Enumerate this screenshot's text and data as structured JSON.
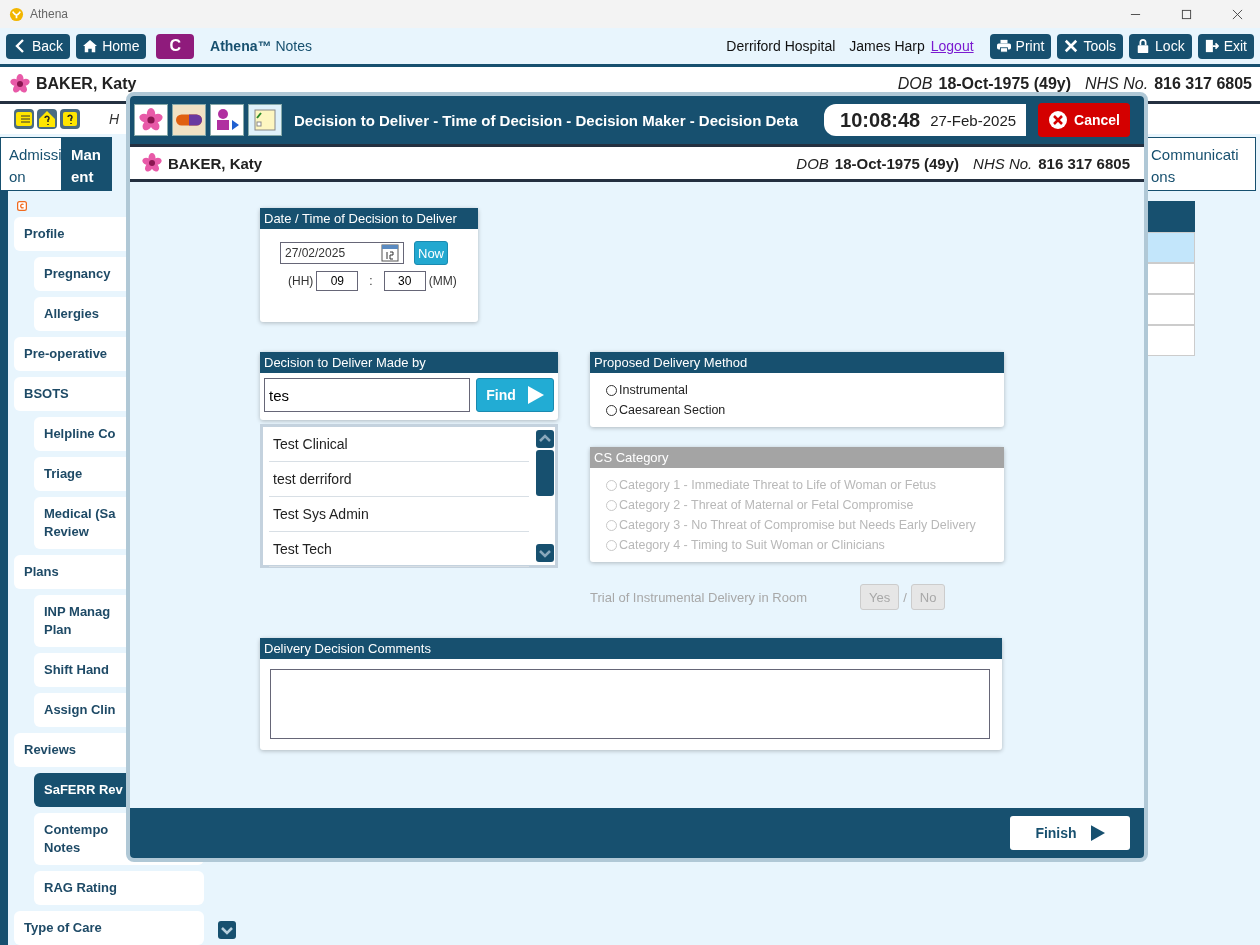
{
  "window": {
    "title": "Athena"
  },
  "toolbar": {
    "back": "Back",
    "home": "Home",
    "c_button": "C",
    "app_name": "Athena™",
    "app_suffix": "Notes",
    "hospital": "Derriford Hospital",
    "user": "James Harp",
    "logout": "Logout",
    "buttons": [
      {
        "kind": "print",
        "label": "Print"
      },
      {
        "kind": "tools",
        "label": "Tools"
      },
      {
        "kind": "lock",
        "label": "Lock"
      },
      {
        "kind": "exit",
        "label": "Exit"
      }
    ]
  },
  "patient": {
    "name": "BAKER, Katy",
    "dob_label": "DOB",
    "dob": "18-Oct-1975 (49y)",
    "nhs_label": "NHS No.",
    "nhs": "816 317 6805"
  },
  "icon_row_text": "H",
  "tabs": [
    {
      "lines": [
        "Admissi",
        "on"
      ],
      "selected": false
    },
    {
      "lines": [
        "Man",
        "ent"
      ],
      "selected": true
    },
    {
      "lines": [
        "Communicati",
        "ons"
      ],
      "selected": false
    }
  ],
  "sidebar": {
    "items": [
      {
        "lines": [
          "Profile"
        ],
        "selected": false,
        "children": [
          {
            "lines": [
              "Pregnancy"
            ],
            "selected": false
          },
          {
            "lines": [
              "Allergies"
            ],
            "selected": false
          }
        ]
      },
      {
        "lines": [
          "Pre-operative"
        ],
        "selected": false
      },
      {
        "lines": [
          "BSOTS"
        ],
        "selected": false,
        "children": [
          {
            "lines": [
              "Helpline Co"
            ],
            "selected": false
          },
          {
            "lines": [
              "Triage"
            ],
            "selected": false
          },
          {
            "lines": [
              "Medical (Sa",
              "Review"
            ],
            "selected": false
          }
        ]
      },
      {
        "lines": [
          "Plans"
        ],
        "selected": false,
        "children": [
          {
            "lines": [
              "INP Manag",
              "Plan"
            ],
            "selected": false
          },
          {
            "lines": [
              "Shift Hand"
            ],
            "selected": false
          },
          {
            "lines": [
              "Assign Clin"
            ],
            "selected": false
          }
        ]
      },
      {
        "lines": [
          "Reviews"
        ],
        "selected": false,
        "children": [
          {
            "lines": [
              "SaFERR Rev"
            ],
            "selected": true
          },
          {
            "lines": [
              "Contempo",
              "Notes"
            ],
            "selected": false
          },
          {
            "lines": [
              "RAG Rating"
            ],
            "selected": false
          }
        ]
      },
      {
        "lines": [
          "Type of Care"
        ],
        "selected": false
      }
    ]
  },
  "table": {
    "rows": [
      {
        "selected": true
      },
      {
        "selected": false
      },
      {
        "selected": false
      },
      {
        "selected": false
      }
    ]
  },
  "dialog": {
    "title": "Decision to Deliver - Time of Decision - Decision Maker - Decision Deta",
    "time": "10:08:48",
    "date": "27-Feb-2025",
    "cancel": "Cancel",
    "patient": {
      "name": "BAKER, Katy",
      "dob_label": "DOB",
      "dob": "18-Oct-1975 (49y)",
      "nhs_label": "NHS No.",
      "nhs": "816 317 6805"
    },
    "datetime": {
      "title": "Date / Time of Decision to Deliver",
      "date": "27/02/2025",
      "now": "Now",
      "hh_label": "(HH)",
      "hh": "09",
      "sep": ":",
      "mm": "30",
      "mm_label": "(MM)"
    },
    "made_by": {
      "title": "Decision to Deliver Made by",
      "query": "tes",
      "find": "Find",
      "results": [
        "Test Clinical",
        "test derriford",
        "Test Sys Admin",
        "Test Tech"
      ]
    },
    "method": {
      "title": "Proposed Delivery Method",
      "disabled": false,
      "options": [
        {
          "label": "Instrumental",
          "checked": false
        },
        {
          "label": "Caesarean Section",
          "checked": false
        }
      ]
    },
    "cs_category": {
      "title": "CS Category",
      "disabled": true,
      "options": [
        {
          "label": "Category 1 - Immediate Threat to Life of Woman or Fetus",
          "checked": false
        },
        {
          "label": "Category 2 - Threat of Maternal or Fetal Compromise",
          "checked": false
        },
        {
          "label": "Category 3 - No Threat of Compromise but Needs Early Delivery",
          "checked": false
        },
        {
          "label": "Category 4 - Timing to Suit Woman or Clinicians",
          "checked": false
        }
      ]
    },
    "trial": {
      "label": "Trial of Instrumental Delivery in Room",
      "disabled": true,
      "yes": "Yes",
      "sep": "/",
      "no": "No"
    },
    "comments": {
      "title": "Delivery Decision Comments"
    },
    "finish": "Finish"
  }
}
